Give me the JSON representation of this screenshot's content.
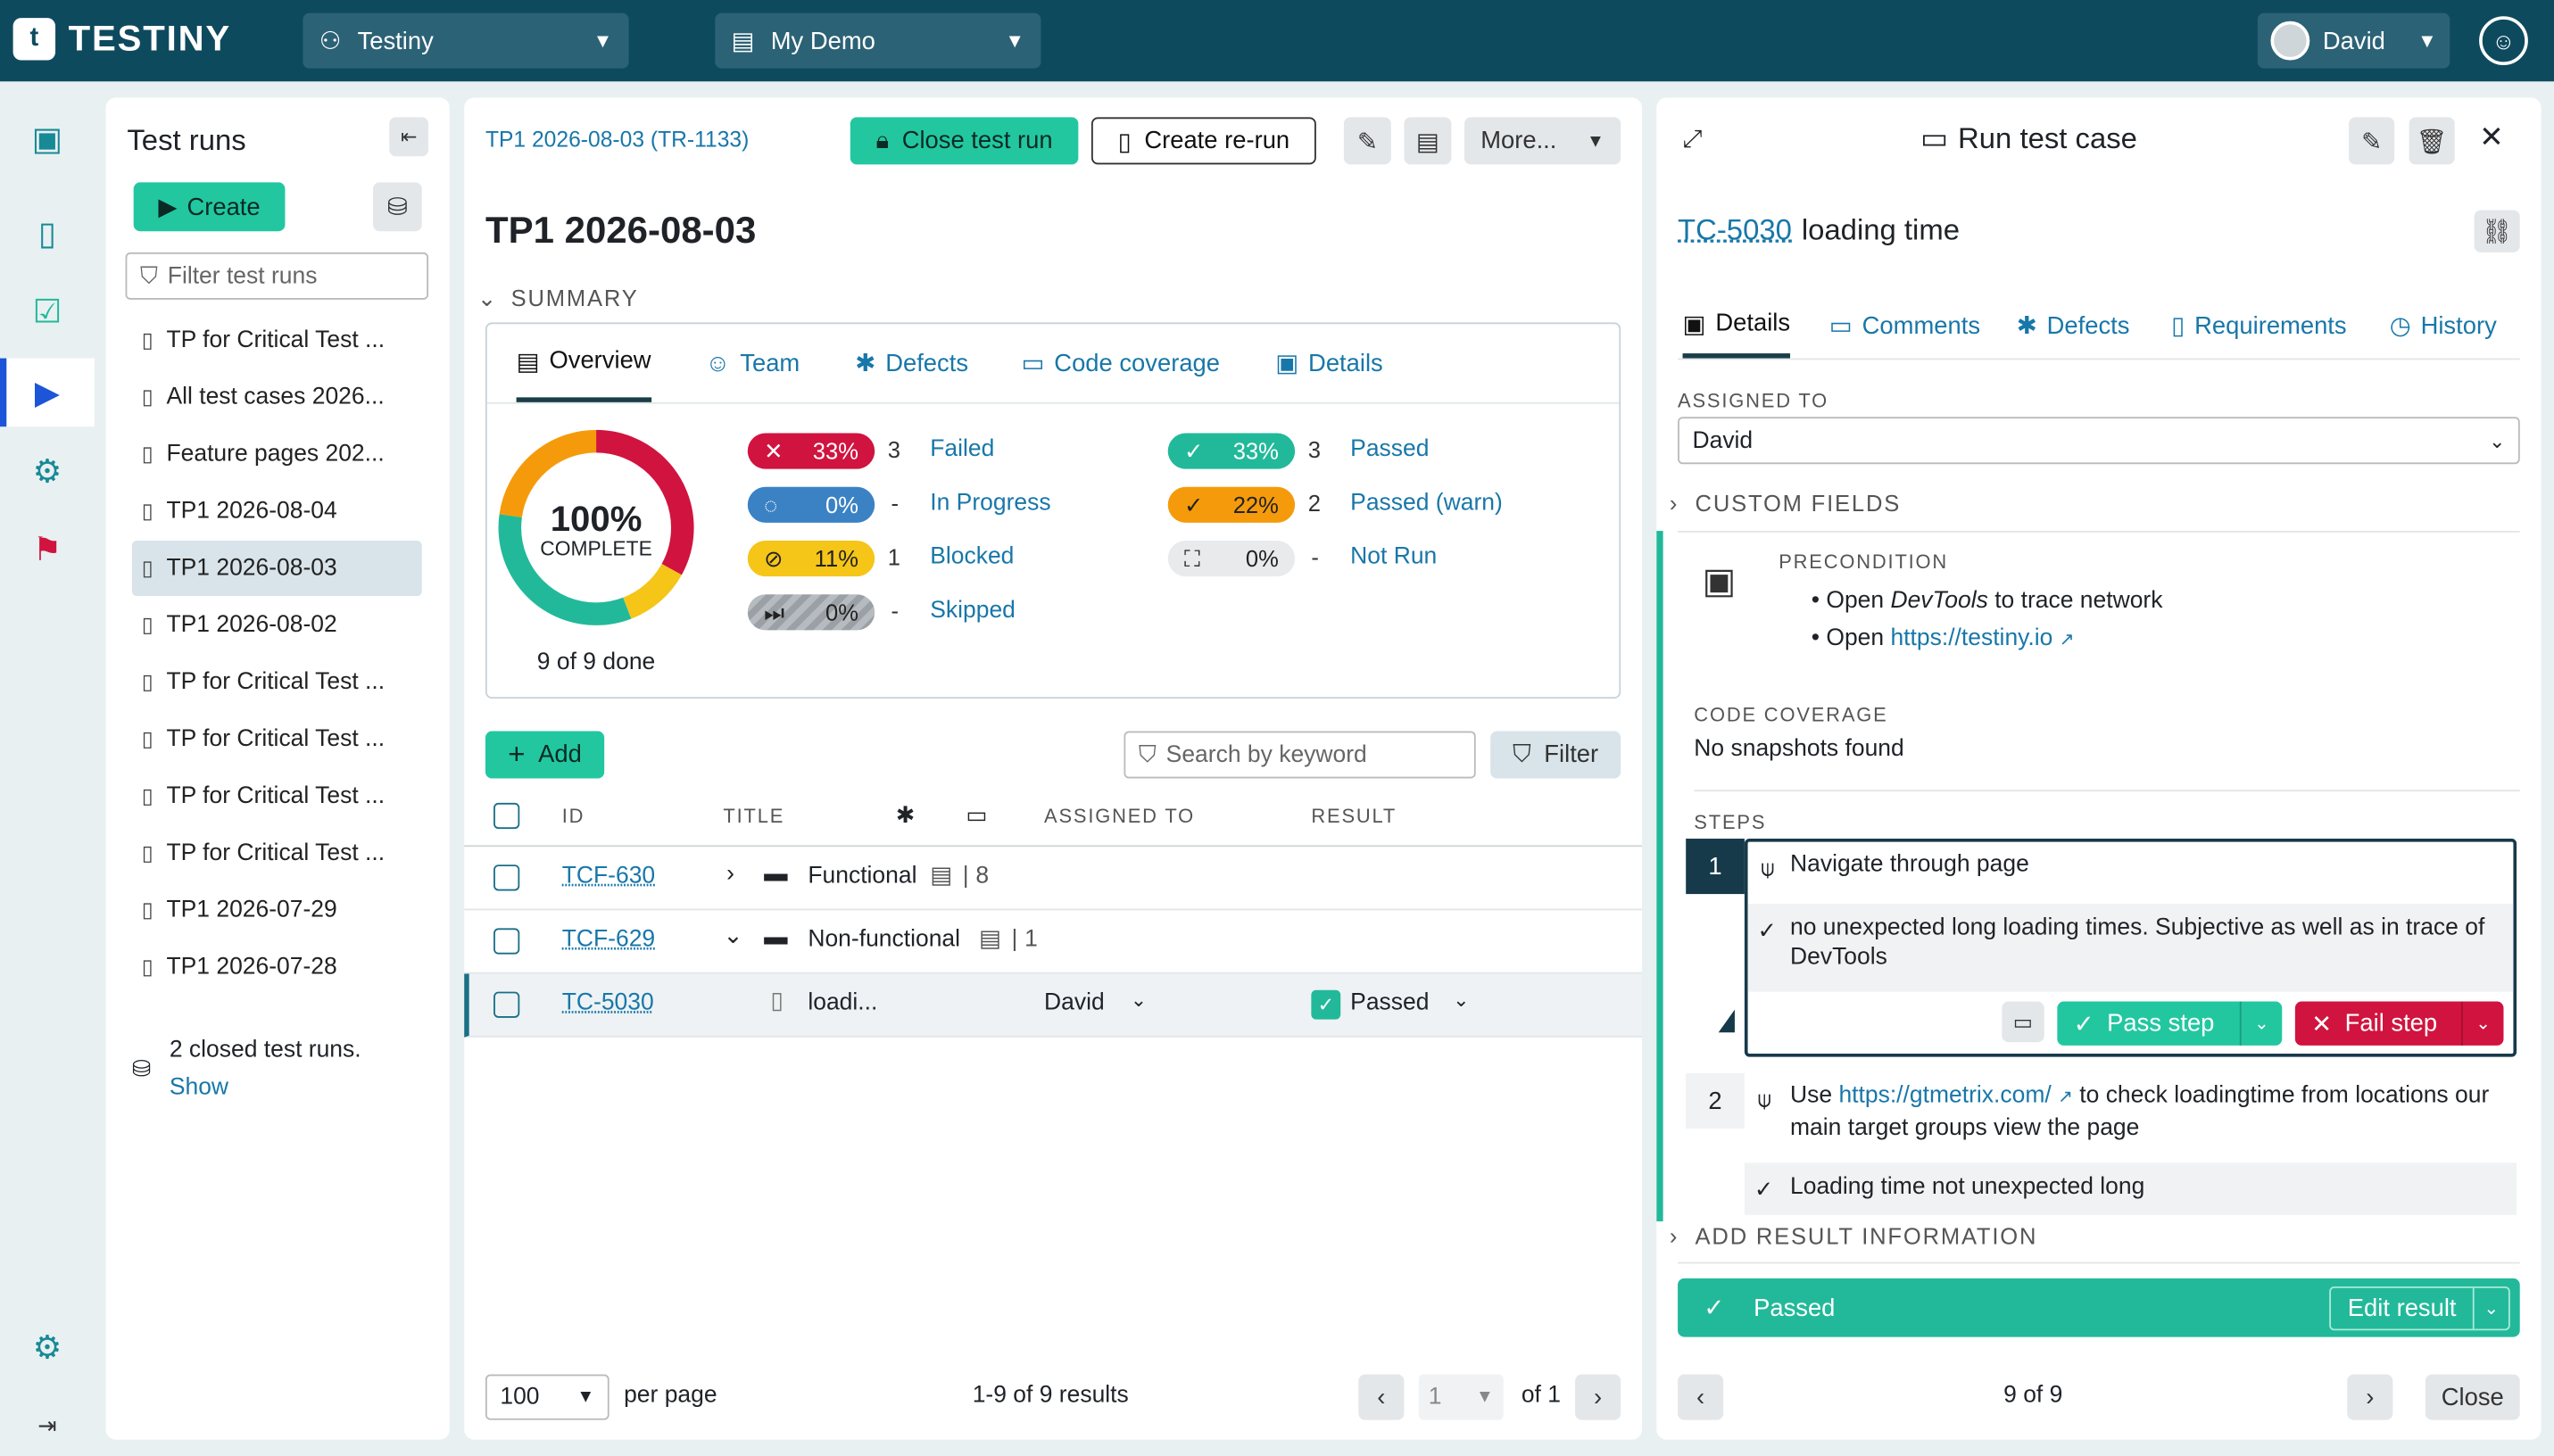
{
  "topbar": {
    "logo_text": "TESTINY",
    "project": "Testiny",
    "demo": "My Demo",
    "user": "David"
  },
  "sidebar": {
    "title": "Test runs",
    "create_label": "Create",
    "filter_placeholder": "Filter test runs",
    "runs": [
      "TP for Critical Test ...",
      "All test cases 2026...",
      "Feature pages 202...",
      "TP1 2026-08-04",
      "TP1 2026-08-03",
      "TP1 2026-08-02",
      "TP for Critical Test ...",
      "TP for Critical Test ...",
      "TP for Critical Test ...",
      "TP for Critical Test ...",
      "TP1 2026-07-29",
      "TP1 2026-07-28"
    ],
    "closed_text": "2 closed test runs.",
    "show_label": "Show"
  },
  "main": {
    "breadcrumb": "TP1 2026-08-03 (TR-1133)",
    "close_label": "Close test run",
    "rerun_label": "Create re-run",
    "more_label": "More...",
    "title": "TP1 2026-08-03",
    "summary_label": "SUMMARY",
    "tabs": [
      "Overview",
      "Team",
      "Defects",
      "Code coverage",
      "Details"
    ],
    "donut": {
      "percent": "100%",
      "label": "COMPLETE",
      "done": "9 of 9 done"
    },
    "stats_left": [
      {
        "pct": "33%",
        "n": "3",
        "label": "Failed",
        "color": "#d1133f"
      },
      {
        "pct": "0%",
        "n": "-",
        "label": "In Progress",
        "color": "#3b82c4"
      },
      {
        "pct": "11%",
        "n": "1",
        "label": "Blocked",
        "color": "#f5c518"
      },
      {
        "pct": "0%",
        "n": "-",
        "label": "Skipped",
        "color": "#9aa0a6"
      }
    ],
    "stats_right": [
      {
        "pct": "33%",
        "n": "3",
        "label": "Passed",
        "color": "#22b99a"
      },
      {
        "pct": "22%",
        "n": "2",
        "label": "Passed (warn)",
        "color": "#f59b0b"
      },
      {
        "pct": "0%",
        "n": "-",
        "label": "Not Run",
        "color": "#e8eaec"
      }
    ],
    "add_label": "Add",
    "search_placeholder": "Search by keyword",
    "filter_label": "Filter",
    "columns": {
      "id": "ID",
      "title": "TITLE",
      "assigned": "ASSIGNED TO",
      "result": "RESULT"
    },
    "rows": [
      {
        "id": "TCF-630",
        "title": "Functional",
        "count": "8"
      },
      {
        "id": "TCF-629",
        "title": "Non-functional",
        "count": "1"
      },
      {
        "id": "TC-5030",
        "title": "loadi...",
        "assigned": "David",
        "result": "Passed"
      }
    ],
    "per_page_value": "100",
    "per_page_label": "per page",
    "results": "1-9 of 9 results",
    "page": "1",
    "page_of": "of 1"
  },
  "detail": {
    "header": "Run test case",
    "tc_id": "TC-5030",
    "tc_title": "loading time",
    "tabs": [
      "Details",
      "Comments",
      "Defects",
      "Requirements",
      "History"
    ],
    "assigned_label": "ASSIGNED TO",
    "assigned_value": "David",
    "custom_fields": "CUSTOM FIELDS",
    "precondition_label": "PRECONDITION",
    "pre_1_a": "Open ",
    "pre_1_b": "DevTools",
    "pre_1_c": " to trace network",
    "pre_2_a": "Open ",
    "pre_2_link": "https://testiny.io",
    "coverage_label": "CODE COVERAGE",
    "coverage_value": "No snapshots found",
    "steps_label": "STEPS",
    "step1_num": "1",
    "step1_text": "Navigate through page",
    "step1_expected": "no unexpected long loading times. Subjective as well as in trace of DevTools",
    "pass_step": "Pass step",
    "fail_step": "Fail step",
    "step2_num": "2",
    "step2_a": "Use ",
    "step2_link": "https://gtmetrix.com/",
    "step2_b": " to check loadingtime from locations our main target groups view the page",
    "step2_expected": "Loading time not unexpected long",
    "add_result": "ADD RESULT INFORMATION",
    "result": "Passed",
    "edit_result": "Edit result",
    "pager": "9 of 9",
    "close_label": "Close"
  }
}
